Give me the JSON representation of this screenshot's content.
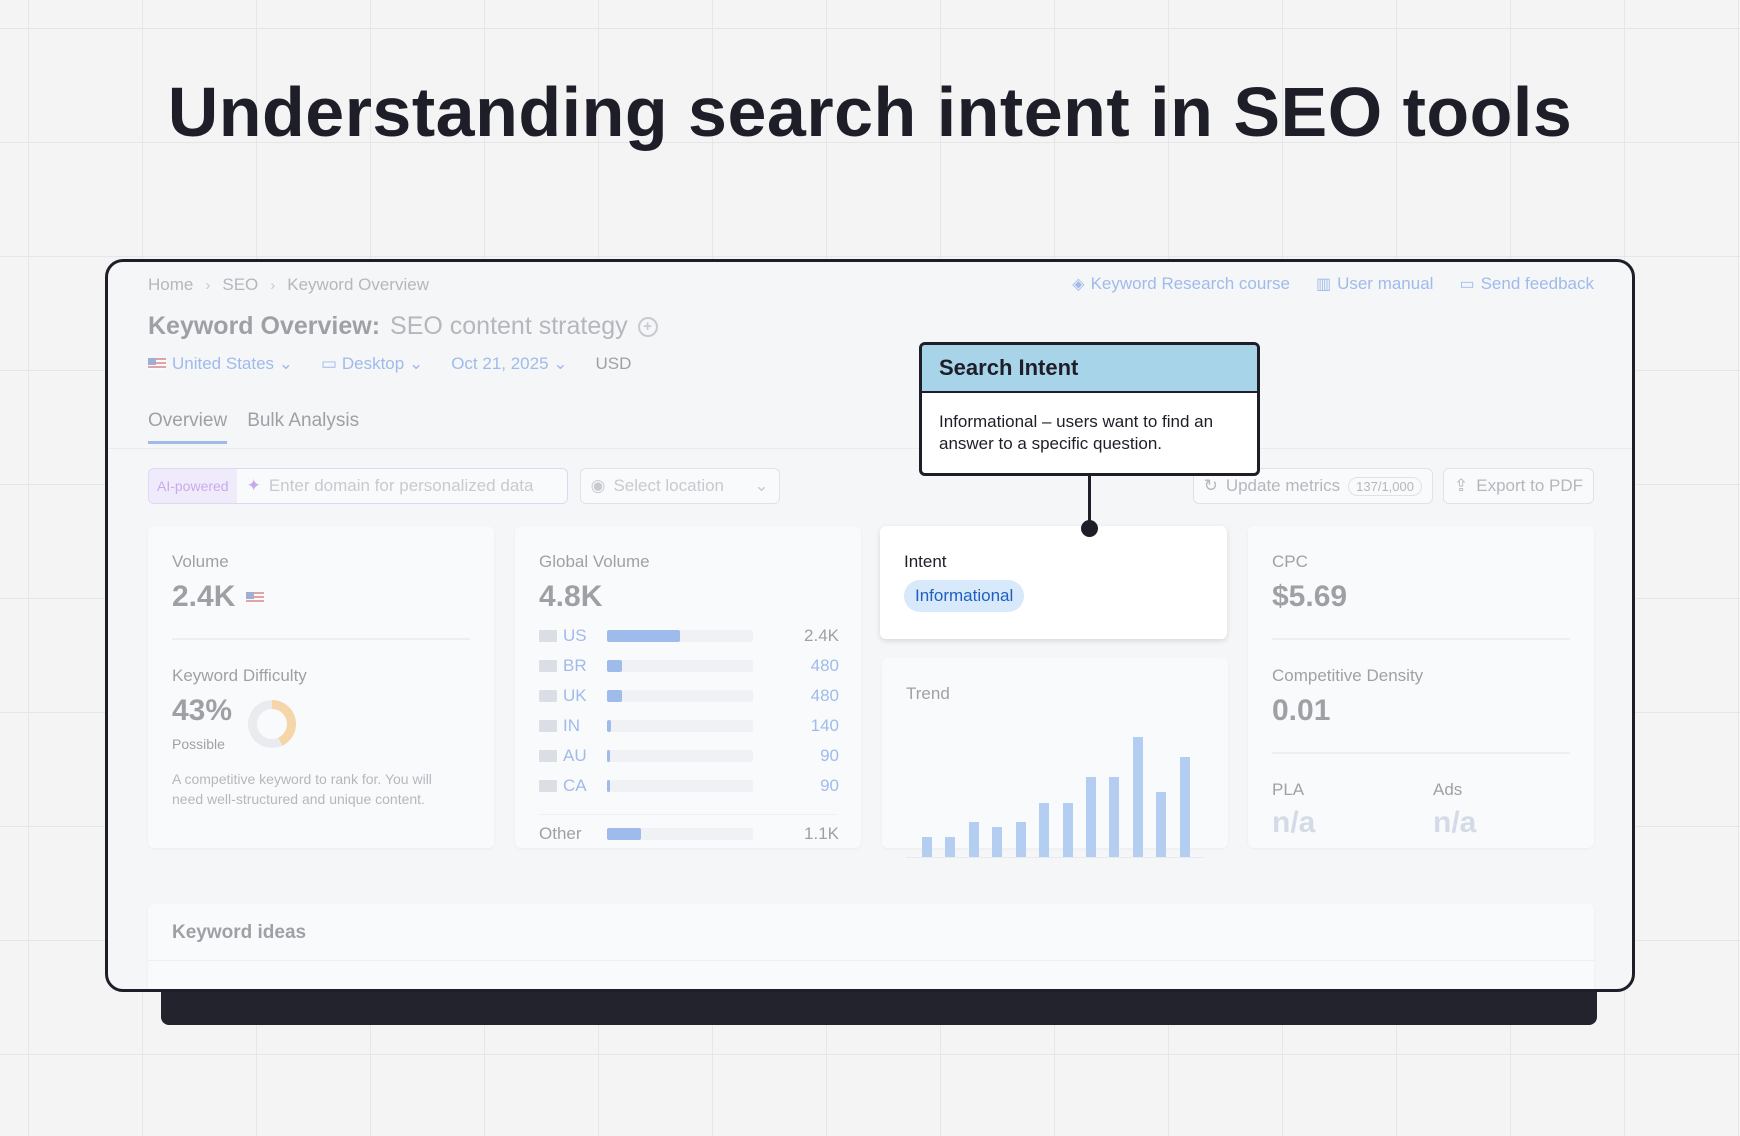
{
  "headline": "Understanding search intent in SEO tools",
  "breadcrumb": [
    "Home",
    "SEO",
    "Keyword Overview"
  ],
  "help_links": [
    {
      "icon": "graduation-cap-icon",
      "label": "Keyword Research course"
    },
    {
      "icon": "book-icon",
      "label": "User manual"
    },
    {
      "icon": "message-icon",
      "label": "Send feedback"
    }
  ],
  "page_title": {
    "prefix": "Keyword Overview:",
    "keyword": "SEO content strategy"
  },
  "filters": {
    "country": "United States",
    "device": "Desktop",
    "date": "Oct 21, 2025",
    "currency": "USD"
  },
  "tabs": [
    "Overview",
    "Bulk Analysis"
  ],
  "toolbar": {
    "ai_tag": "AI-powered",
    "domain_placeholder": "Enter domain for personalized data",
    "location_placeholder": "Select location",
    "update_label": "Update metrics",
    "update_count": "137/1,000",
    "export_label": "Export to PDF"
  },
  "volume": {
    "label": "Volume",
    "value": "2.4K"
  },
  "difficulty": {
    "label": "Keyword Difficulty",
    "value": "43%",
    "level": "Possible",
    "percent": 43,
    "description_line1": "A competitive keyword to rank for. You will",
    "description_line2": "need well-structured and unique content."
  },
  "global_volume": {
    "label": "Global Volume",
    "value": "4.8K",
    "rows": [
      {
        "country": "US",
        "value": "2.4K",
        "share": 0.5
      },
      {
        "country": "BR",
        "value": "480",
        "share": 0.1
      },
      {
        "country": "UK",
        "value": "480",
        "share": 0.1
      },
      {
        "country": "IN",
        "value": "140",
        "share": 0.03
      },
      {
        "country": "AU",
        "value": "90",
        "share": 0.02
      },
      {
        "country": "CA",
        "value": "90",
        "share": 0.02
      }
    ],
    "other": {
      "country": "Other",
      "value": "1.1K",
      "share": 0.23
    }
  },
  "intent": {
    "label": "Intent",
    "value": "Informational"
  },
  "trend": {
    "label": "Trend",
    "values": [
      17,
      17,
      29,
      25,
      29,
      45,
      45,
      67,
      67,
      100,
      54,
      83
    ]
  },
  "cpc": {
    "label": "CPC",
    "value": "$5.69"
  },
  "competitive_density": {
    "label": "Competitive Density",
    "value": "0.01"
  },
  "pla": {
    "label": "PLA",
    "value": "n/a"
  },
  "ads": {
    "label": "Ads",
    "value": "n/a"
  },
  "keyword_ideas": {
    "label": "Keyword ideas"
  },
  "callout": {
    "title": "Search Intent",
    "body_line1": "Informational – users want to find an",
    "body_line2": "answer to a specific question."
  },
  "colors": {
    "accent": "#2a6ad8",
    "callout_header": "#a8d4ea",
    "intent_pill": "#d7e9fb",
    "ai": "#8a3fe0"
  }
}
